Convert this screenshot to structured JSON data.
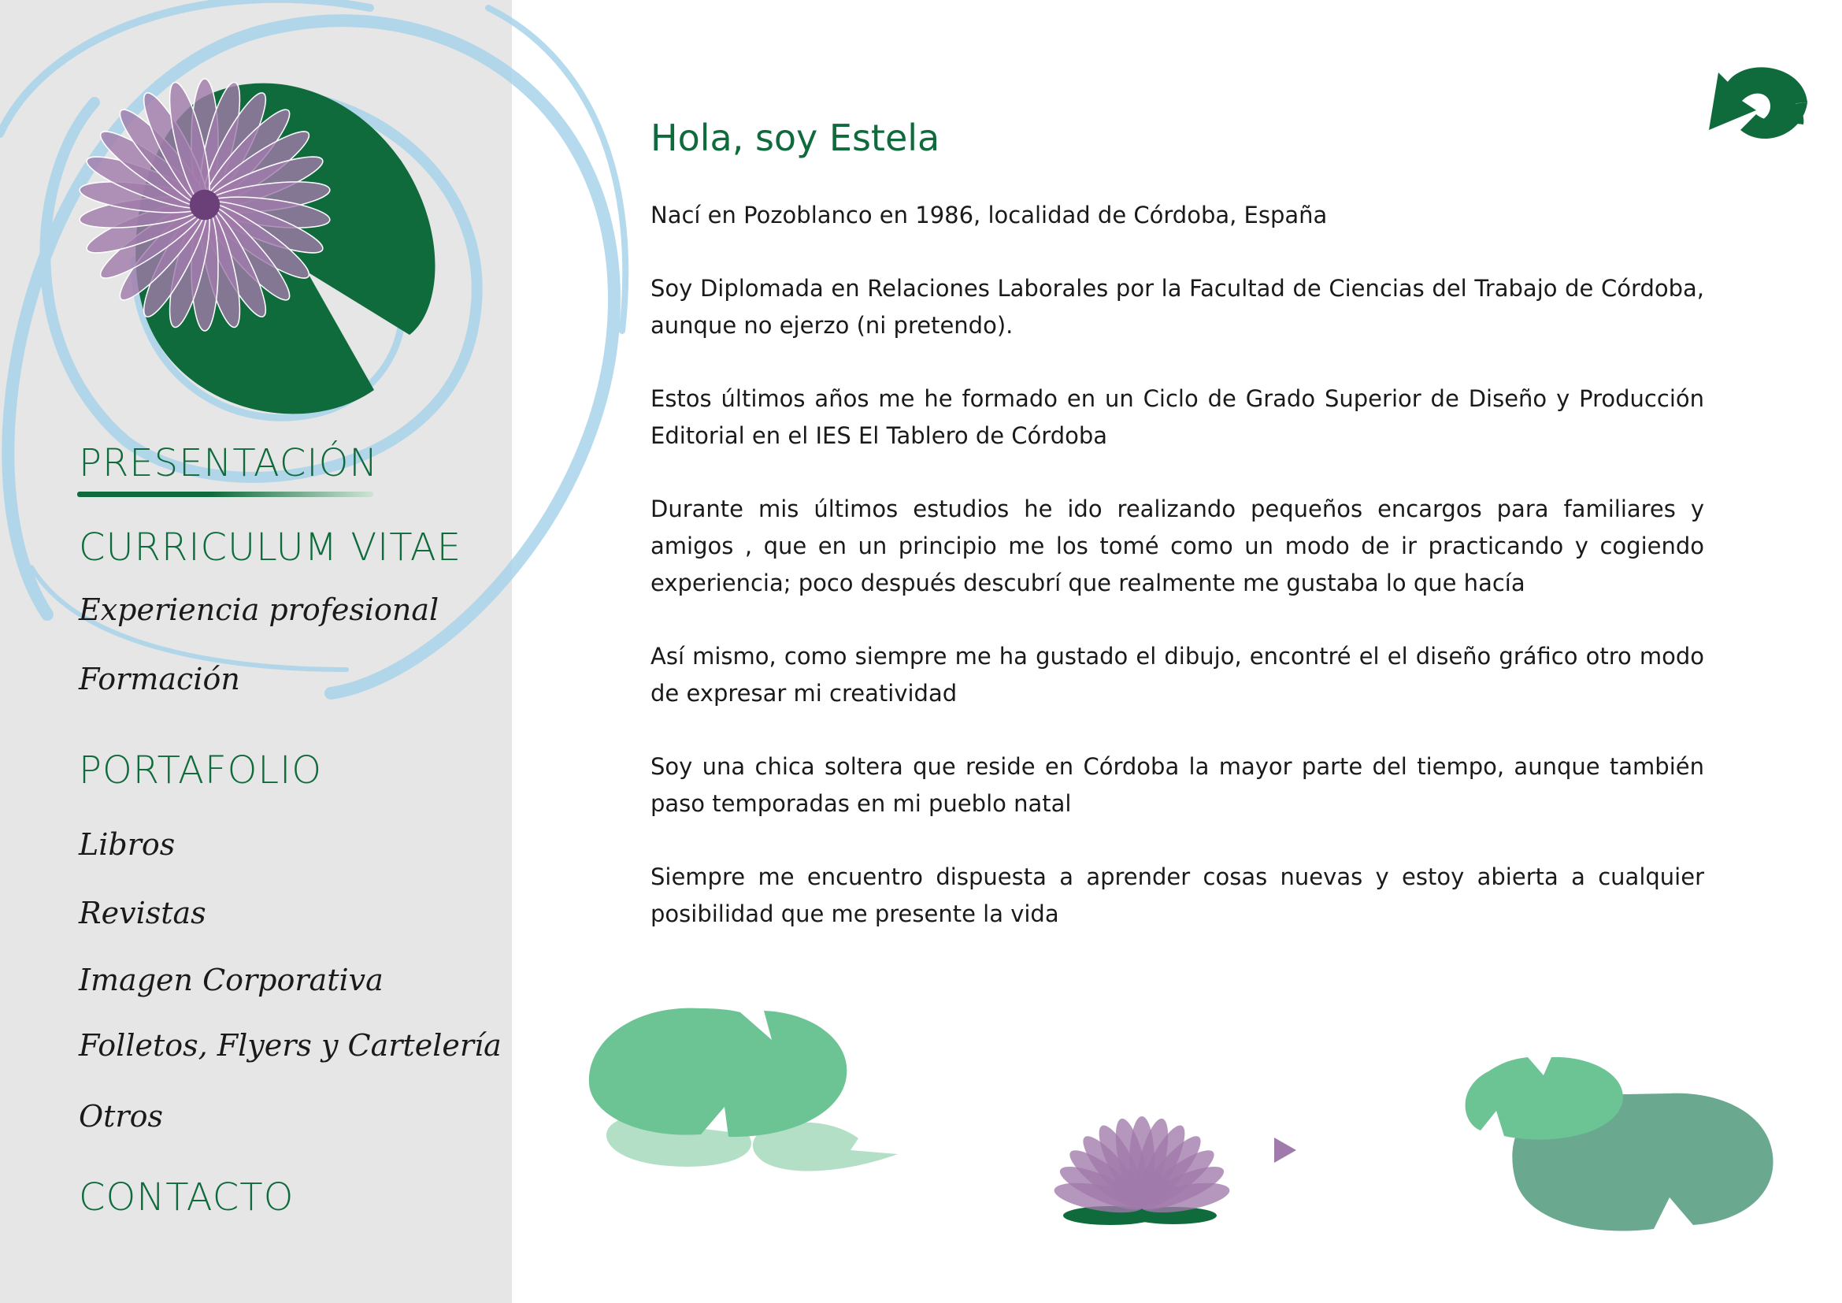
{
  "colors": {
    "accent": "#0f6b3c",
    "sidebar_bg": "#e6e6e6",
    "swirl": "#a9d4ea",
    "petal": "#a07aaa",
    "leaf_light": "#6cc495"
  },
  "sidebar": {
    "nav": [
      {
        "label": "PRESENTACIÓN",
        "active": true
      },
      {
        "label": "CURRICULUM VITAE",
        "items": [
          {
            "label": "Experiencia profesional"
          },
          {
            "label": "Formación"
          }
        ]
      },
      {
        "label": "PORTAFOLIO",
        "items": [
          {
            "label": "Libros"
          },
          {
            "label": "Revistas"
          },
          {
            "label": "Imagen Corporativa"
          },
          {
            "label": "Folletos, Flyers y Cartelería"
          },
          {
            "label": "Otros"
          }
        ]
      },
      {
        "label": "CONTACTO"
      }
    ]
  },
  "main": {
    "title": "Hola, soy Estela",
    "paragraphs": [
      "Nací en Pozoblanco en 1986,  localidad de Córdoba, España",
      "Soy Diplomada en Relaciones Laborales por la Facultad de Ciencias del Trabajo de Córdoba, aunque no ejerzo (ni pretendo).",
      "Estos últimos años me he formado en un Ciclo de Grado Superior de Diseño y Producción Editorial en el IES El Tablero de Córdoba",
      "Durante mis últimos estudios he ido realizando pequeños encargos para familiares y amigos , que en un principio me los tomé como un modo de ir practicando y cogiendo experiencia; poco después descubrí que realmente me gustaba lo que hacía",
      "Así mismo, como siempre me ha gustado el dibujo, encontré el el diseño gráfico otro modo de expresar mi creatividad",
      "Soy una chica soltera que reside en Córdoba la mayor parte del tiempo, aunque también paso temporadas en mi pueblo natal",
      "Siempre me encuentro dispuesta a aprender cosas nuevas y estoy abierta a cualquier posibilidad que me presente la vida"
    ]
  },
  "icons": {
    "back": "back-arrow-icon",
    "next": "play-triangle-icon"
  }
}
